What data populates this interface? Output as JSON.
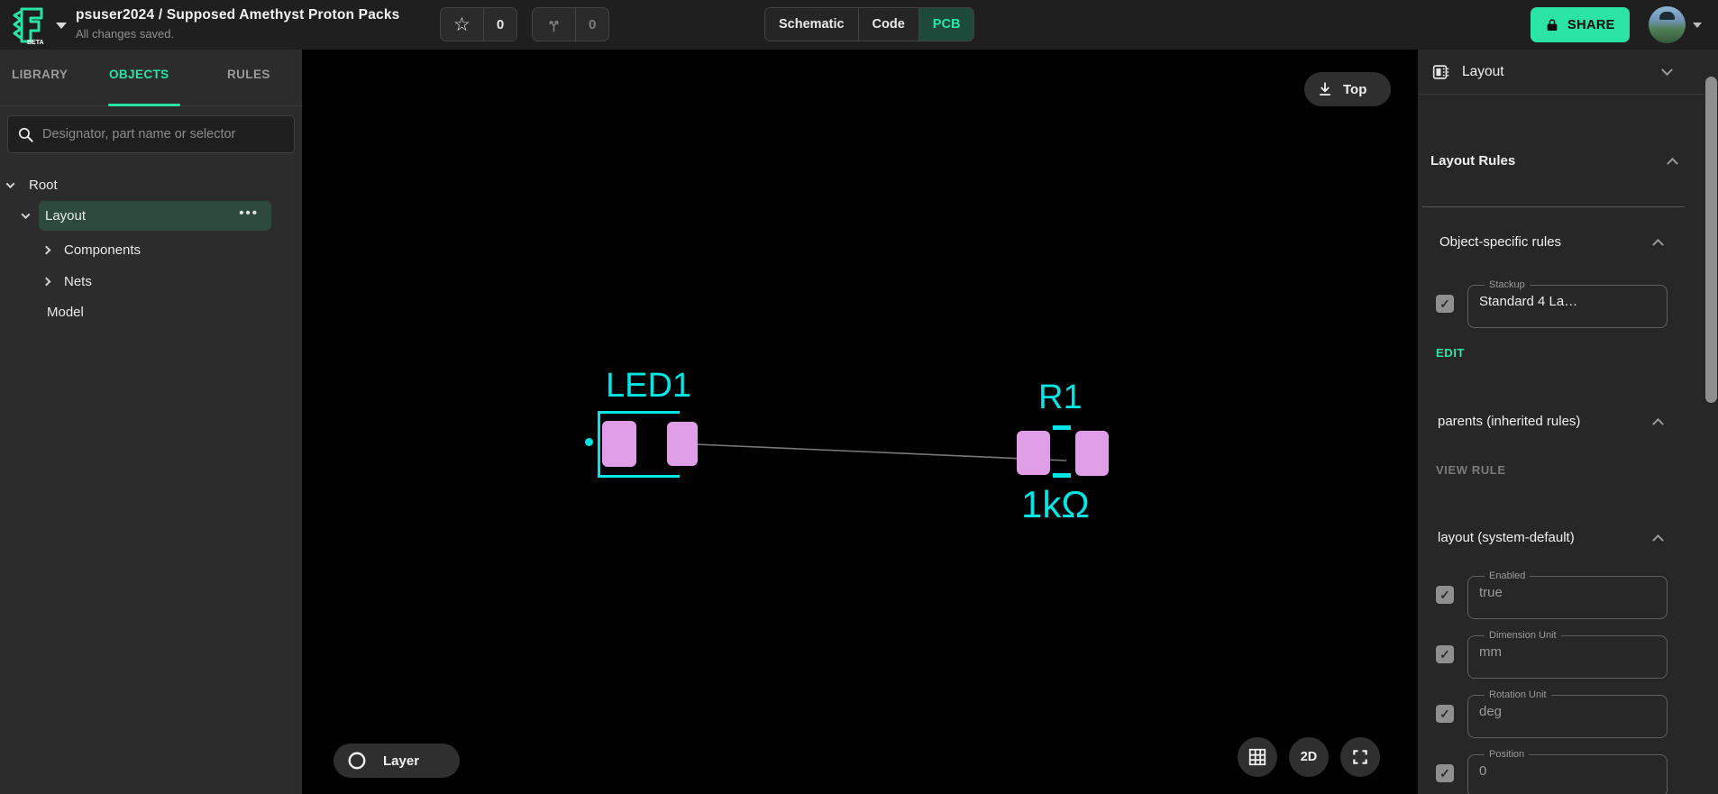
{
  "topbar": {
    "beta": "BETA",
    "title": "psuser2024 / Supposed Amethyst Proton Packs",
    "subtitle": "All changes saved.",
    "star_count": "0",
    "fork_count": "0",
    "tab_schematic": "Schematic",
    "tab_code": "Code",
    "tab_pcb": "PCB",
    "share": "SHARE"
  },
  "sidebar": {
    "tab_library": "LIBRARY",
    "tab_objects": "OBJECTS",
    "tab_rules": "RULES",
    "search_placeholder": "Designator, part name or selector",
    "tree": [
      {
        "label": "Root"
      },
      {
        "label": "Layout"
      },
      {
        "label": "Components"
      },
      {
        "label": "Nets"
      },
      {
        "label": "Model"
      }
    ]
  },
  "canvas": {
    "top_button": "Top",
    "layer_button": "Layer",
    "btn_2d": "2D",
    "led_designator": "LED1",
    "resistor_designator": "R1",
    "resistor_value": "1kΩ",
    "silkscreen_color": "#00e5e5",
    "pad_color": "#df9ee6",
    "accent_color": "#2ae3a5"
  },
  "panel": {
    "header": "Layout",
    "layout_rules": "Layout Rules",
    "object_specific": "Object-specific rules",
    "stackup_label": "Stackup",
    "stackup_value": "Standard 4 La…",
    "edit": "EDIT",
    "parents": "parents (inherited rules)",
    "view_rule": "VIEW RULE",
    "layout_default": "layout (system-default)",
    "fields": [
      {
        "label": "Enabled",
        "value": "true"
      },
      {
        "label": "Dimension Unit",
        "value": "mm"
      },
      {
        "label": "Rotation Unit",
        "value": "deg"
      },
      {
        "label": "Position",
        "value": "0"
      }
    ]
  }
}
